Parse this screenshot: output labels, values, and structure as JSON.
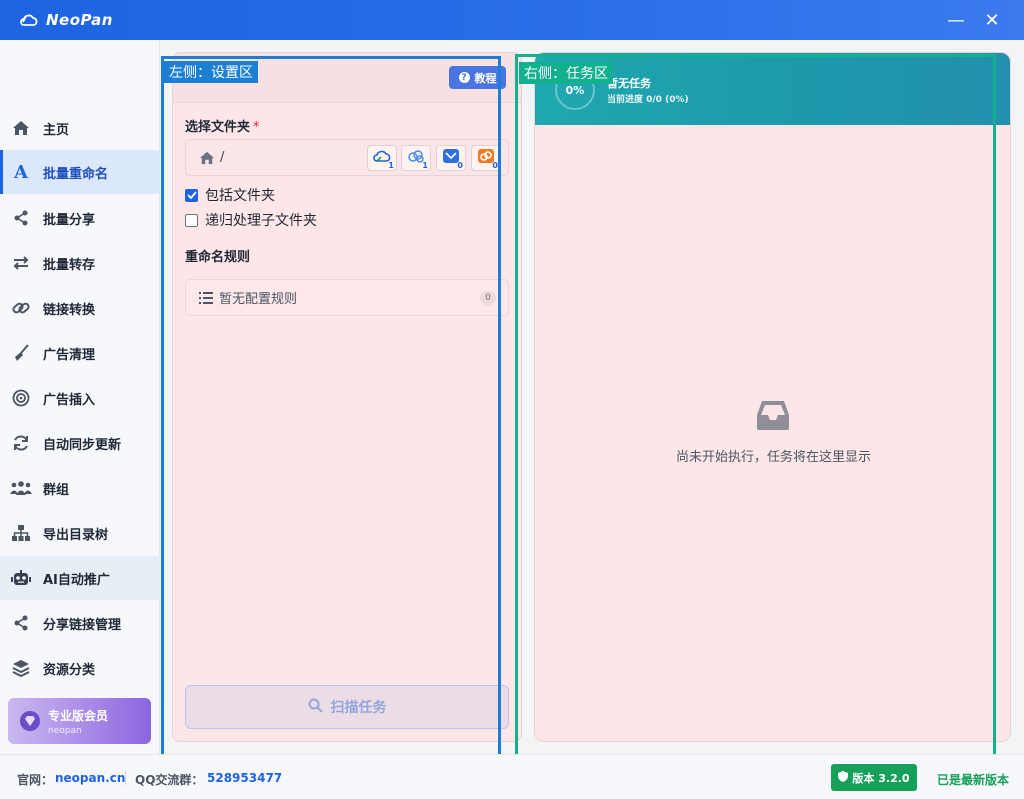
{
  "app": {
    "title": "NeoPan"
  },
  "window": {
    "minimize_label": "—",
    "close_label": "✕"
  },
  "sidebar": {
    "items": [
      {
        "label": "主页",
        "icon": "home-icon"
      },
      {
        "label": "批量重命名",
        "icon": "font-a-icon",
        "active": true
      },
      {
        "label": "批量分享",
        "icon": "share-icon"
      },
      {
        "label": "批量转存",
        "icon": "transfer-icon"
      },
      {
        "label": "链接转换",
        "icon": "link-icon"
      },
      {
        "label": "广告清理",
        "icon": "broom-icon"
      },
      {
        "label": "广告插入",
        "icon": "target-icon"
      },
      {
        "label": "自动同步更新",
        "icon": "sync-icon"
      },
      {
        "label": "群组",
        "icon": "group-icon"
      },
      {
        "label": "导出目录树",
        "icon": "sitemap-icon"
      },
      {
        "label": "AI自动推广",
        "icon": "robot-icon"
      },
      {
        "label": "分享链接管理",
        "icon": "share-icon"
      },
      {
        "label": "资源分类",
        "icon": "layers-icon"
      }
    ],
    "vip": {
      "title": "专业版会员",
      "subtitle": "neopan"
    }
  },
  "left_panel": {
    "tutorial_label": "教程",
    "folder_label": "选择文件夹",
    "required_mark": "*",
    "folder_path": "/",
    "cloud_buttons": [
      {
        "icon": "cloud-icon",
        "count": "1"
      },
      {
        "icon": "cloud-alt-icon",
        "count": "1"
      },
      {
        "icon": "mail-cloud-icon",
        "count": "0"
      },
      {
        "icon": "orange-cloud-icon",
        "count": "0"
      }
    ],
    "include_folders": {
      "label": "包括文件夹",
      "checked": true
    },
    "recursive": {
      "label": "递归处理子文件夹",
      "checked": false
    },
    "rules_label": "重命名规则",
    "rules_empty": "暂无配置规则",
    "rules_count": "0",
    "scan_label": "扫描任务"
  },
  "right_panel": {
    "progress_percent": "0%",
    "title": "暂无任务",
    "subtitle": "当前进度 0/0 (0%)",
    "empty_message": "尚未开始执行，任务将在这里显示"
  },
  "annotations": {
    "left": "左侧：设置区",
    "right": "右侧：任务区"
  },
  "footer": {
    "site_label": "官网：",
    "site_link": "neopan.cn",
    "qq_label": "QQ交流群：",
    "qq_number": "528953477",
    "version": "版本 3.2.0",
    "latest": "已是最新版本"
  },
  "colors": {
    "brand": "#1e63e0",
    "teal": "#1fa8b0",
    "success": "#17a05a",
    "annotation_left": "#1c7fd4",
    "annotation_right": "#13b08f"
  }
}
